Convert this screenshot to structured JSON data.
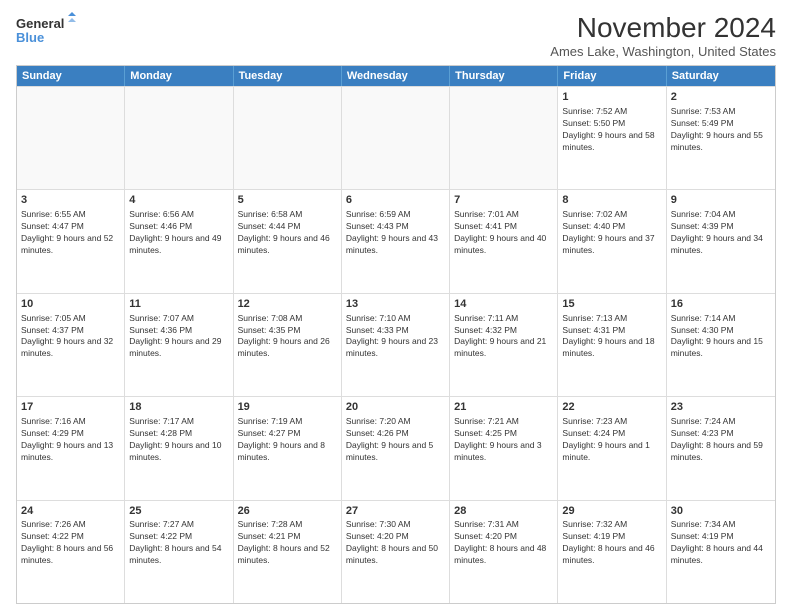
{
  "logo": {
    "line1": "General",
    "line2": "Blue"
  },
  "title": "November 2024",
  "location": "Ames Lake, Washington, United States",
  "days_of_week": [
    "Sunday",
    "Monday",
    "Tuesday",
    "Wednesday",
    "Thursday",
    "Friday",
    "Saturday"
  ],
  "rows": [
    [
      {
        "day": "",
        "text": "",
        "empty": true
      },
      {
        "day": "",
        "text": "",
        "empty": true
      },
      {
        "day": "",
        "text": "",
        "empty": true
      },
      {
        "day": "",
        "text": "",
        "empty": true
      },
      {
        "day": "",
        "text": "",
        "empty": true
      },
      {
        "day": "1",
        "text": "Sunrise: 7:52 AM\nSunset: 5:50 PM\nDaylight: 9 hours and 58 minutes."
      },
      {
        "day": "2",
        "text": "Sunrise: 7:53 AM\nSunset: 5:49 PM\nDaylight: 9 hours and 55 minutes."
      }
    ],
    [
      {
        "day": "3",
        "text": "Sunrise: 6:55 AM\nSunset: 4:47 PM\nDaylight: 9 hours and 52 minutes."
      },
      {
        "day": "4",
        "text": "Sunrise: 6:56 AM\nSunset: 4:46 PM\nDaylight: 9 hours and 49 minutes."
      },
      {
        "day": "5",
        "text": "Sunrise: 6:58 AM\nSunset: 4:44 PM\nDaylight: 9 hours and 46 minutes."
      },
      {
        "day": "6",
        "text": "Sunrise: 6:59 AM\nSunset: 4:43 PM\nDaylight: 9 hours and 43 minutes."
      },
      {
        "day": "7",
        "text": "Sunrise: 7:01 AM\nSunset: 4:41 PM\nDaylight: 9 hours and 40 minutes."
      },
      {
        "day": "8",
        "text": "Sunrise: 7:02 AM\nSunset: 4:40 PM\nDaylight: 9 hours and 37 minutes."
      },
      {
        "day": "9",
        "text": "Sunrise: 7:04 AM\nSunset: 4:39 PM\nDaylight: 9 hours and 34 minutes."
      }
    ],
    [
      {
        "day": "10",
        "text": "Sunrise: 7:05 AM\nSunset: 4:37 PM\nDaylight: 9 hours and 32 minutes."
      },
      {
        "day": "11",
        "text": "Sunrise: 7:07 AM\nSunset: 4:36 PM\nDaylight: 9 hours and 29 minutes."
      },
      {
        "day": "12",
        "text": "Sunrise: 7:08 AM\nSunset: 4:35 PM\nDaylight: 9 hours and 26 minutes."
      },
      {
        "day": "13",
        "text": "Sunrise: 7:10 AM\nSunset: 4:33 PM\nDaylight: 9 hours and 23 minutes."
      },
      {
        "day": "14",
        "text": "Sunrise: 7:11 AM\nSunset: 4:32 PM\nDaylight: 9 hours and 21 minutes."
      },
      {
        "day": "15",
        "text": "Sunrise: 7:13 AM\nSunset: 4:31 PM\nDaylight: 9 hours and 18 minutes."
      },
      {
        "day": "16",
        "text": "Sunrise: 7:14 AM\nSunset: 4:30 PM\nDaylight: 9 hours and 15 minutes."
      }
    ],
    [
      {
        "day": "17",
        "text": "Sunrise: 7:16 AM\nSunset: 4:29 PM\nDaylight: 9 hours and 13 minutes."
      },
      {
        "day": "18",
        "text": "Sunrise: 7:17 AM\nSunset: 4:28 PM\nDaylight: 9 hours and 10 minutes."
      },
      {
        "day": "19",
        "text": "Sunrise: 7:19 AM\nSunset: 4:27 PM\nDaylight: 9 hours and 8 minutes."
      },
      {
        "day": "20",
        "text": "Sunrise: 7:20 AM\nSunset: 4:26 PM\nDaylight: 9 hours and 5 minutes."
      },
      {
        "day": "21",
        "text": "Sunrise: 7:21 AM\nSunset: 4:25 PM\nDaylight: 9 hours and 3 minutes."
      },
      {
        "day": "22",
        "text": "Sunrise: 7:23 AM\nSunset: 4:24 PM\nDaylight: 9 hours and 1 minute."
      },
      {
        "day": "23",
        "text": "Sunrise: 7:24 AM\nSunset: 4:23 PM\nDaylight: 8 hours and 59 minutes."
      }
    ],
    [
      {
        "day": "24",
        "text": "Sunrise: 7:26 AM\nSunset: 4:22 PM\nDaylight: 8 hours and 56 minutes."
      },
      {
        "day": "25",
        "text": "Sunrise: 7:27 AM\nSunset: 4:22 PM\nDaylight: 8 hours and 54 minutes."
      },
      {
        "day": "26",
        "text": "Sunrise: 7:28 AM\nSunset: 4:21 PM\nDaylight: 8 hours and 52 minutes."
      },
      {
        "day": "27",
        "text": "Sunrise: 7:30 AM\nSunset: 4:20 PM\nDaylight: 8 hours and 50 minutes."
      },
      {
        "day": "28",
        "text": "Sunrise: 7:31 AM\nSunset: 4:20 PM\nDaylight: 8 hours and 48 minutes."
      },
      {
        "day": "29",
        "text": "Sunrise: 7:32 AM\nSunset: 4:19 PM\nDaylight: 8 hours and 46 minutes."
      },
      {
        "day": "30",
        "text": "Sunrise: 7:34 AM\nSunset: 4:19 PM\nDaylight: 8 hours and 44 minutes."
      }
    ]
  ]
}
